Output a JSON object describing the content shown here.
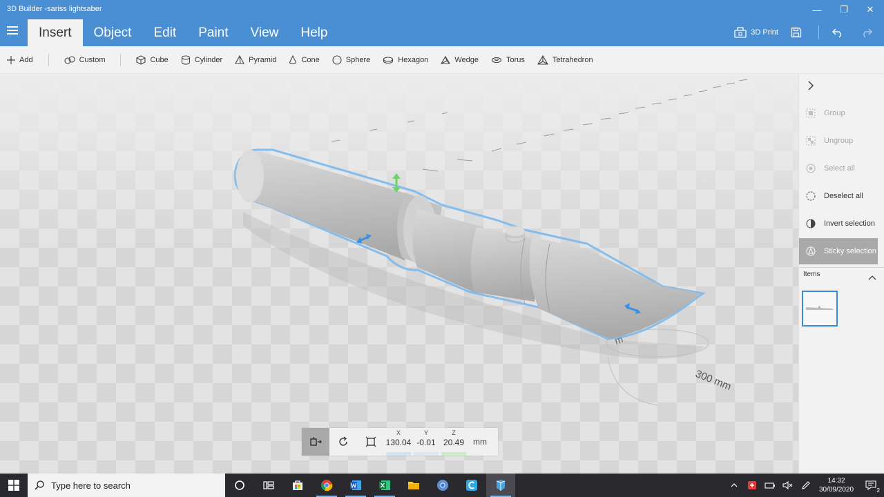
{
  "window": {
    "title": "3D Builder -sariss lightsaber",
    "minimize_glyph": "—",
    "maximize_glyph": "❐",
    "close_glyph": "✕"
  },
  "ribbon": {
    "tabs": [
      {
        "label": "Insert",
        "active": true
      },
      {
        "label": "Object"
      },
      {
        "label": "Edit"
      },
      {
        "label": "Paint"
      },
      {
        "label": "View"
      },
      {
        "label": "Help"
      }
    ],
    "print_label": "3D Print"
  },
  "toolbar": {
    "add_label": "Add",
    "custom_label": "Custom",
    "shapes": [
      "Cube",
      "Cylinder",
      "Pyramid",
      "Cone",
      "Sphere",
      "Hexagon",
      "Wedge",
      "Torus",
      "Tetrahedron"
    ]
  },
  "viewport": {
    "ruler_label": "300 mm",
    "ruler_stub": "m",
    "selection_color": "#7ab8ec",
    "floor_colors": [
      "#d6d6d6",
      "#e3e3e3"
    ]
  },
  "transform": {
    "x_label": "X",
    "x_value": "130.04",
    "y_label": "Y",
    "y_value": "-0.01",
    "z_label": "Z",
    "z_value": "20.49",
    "unit": "mm"
  },
  "sidepanel": {
    "items": [
      {
        "label": "Group",
        "enabled": false
      },
      {
        "label": "Ungroup",
        "enabled": false
      },
      {
        "label": "Select all",
        "enabled": false
      },
      {
        "label": "Deselect all",
        "enabled": true
      },
      {
        "label": "Invert selection",
        "enabled": true
      },
      {
        "label": "Sticky selection",
        "enabled": true,
        "active": true
      }
    ],
    "items_header": "Items"
  },
  "taskbar": {
    "search_placeholder": "Type here to search",
    "time": "14:32",
    "date": "30/09/2020",
    "notification_count": "2"
  },
  "colors": {
    "titlebar": "#4a8fd4",
    "accent": "#3a8ad6",
    "taskbar": "#2a2a2e"
  }
}
